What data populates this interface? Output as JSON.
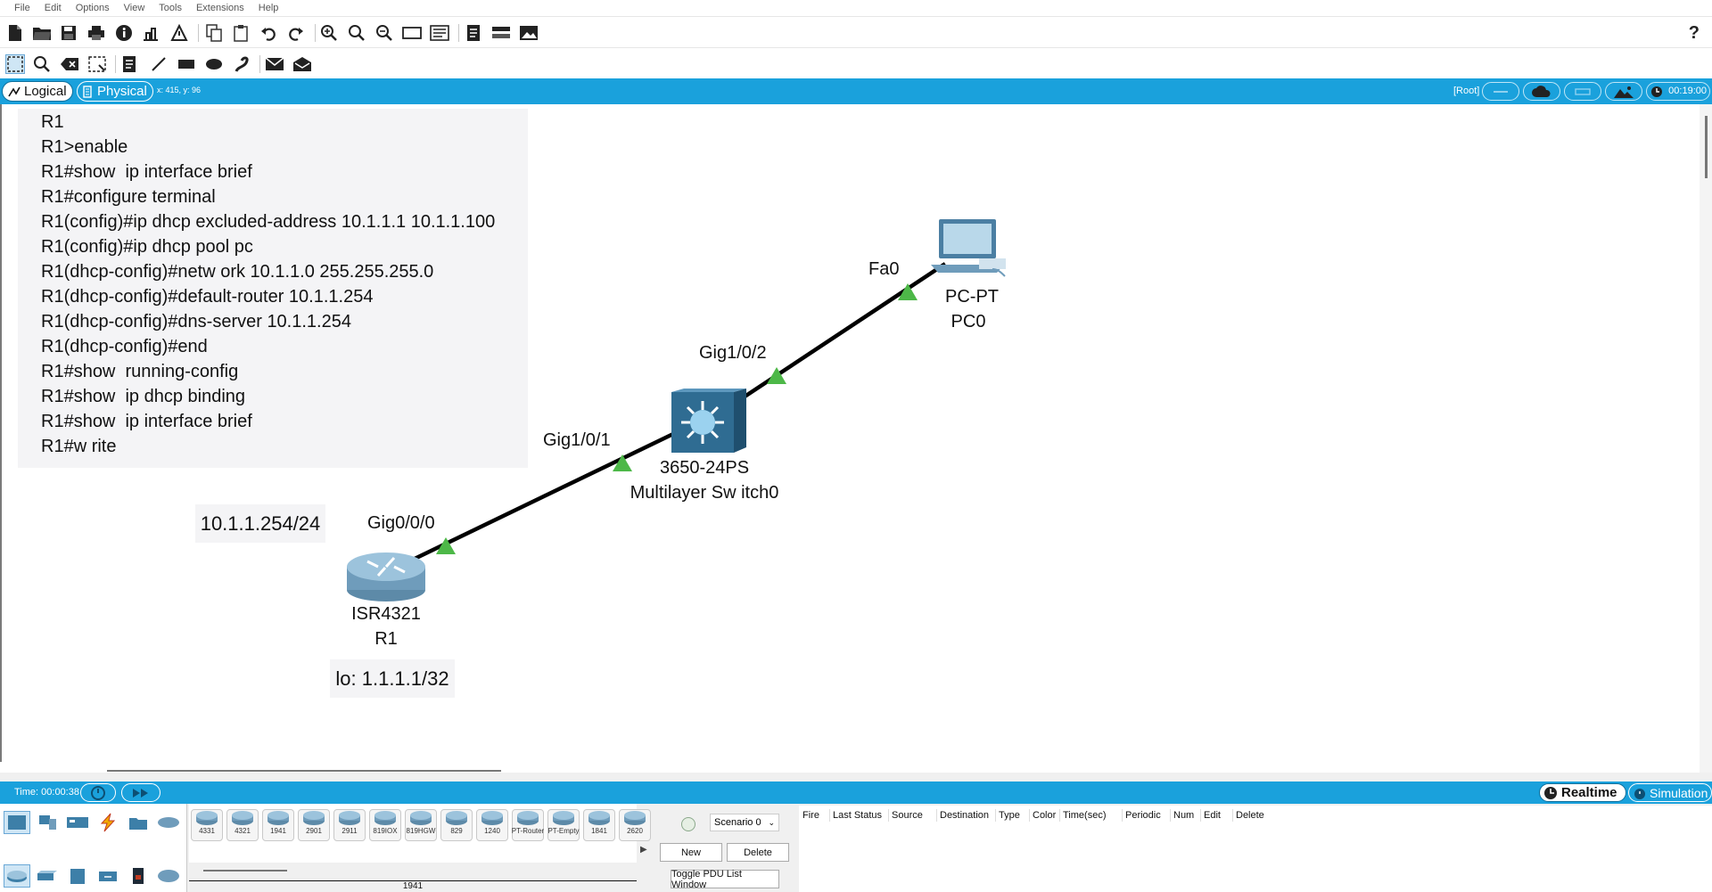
{
  "menu": [
    "File",
    "Edit",
    "Options",
    "View",
    "Tools",
    "Extensions",
    "Help"
  ],
  "workspace": {
    "logical_tab": "Logical",
    "physical_tab": "Physical",
    "coord_readout": "x: 415, y: 96",
    "root_label": "[Root]",
    "clock": "00:19:00"
  },
  "note_lines": [
    "R1",
    "R1>enable",
    "R1#show  ip interface brief",
    "R1#configure terminal",
    "R1(config)#ip dhcp excluded-address 10.1.1.1 10.1.1.100",
    "R1(config)#ip dhcp pool pc",
    "R1(dhcp-config)#netw ork 10.1.1.0 255.255.255.0",
    "R1(dhcp-config)#default-router 10.1.1.254",
    "R1(dhcp-config)#dns-server 10.1.1.254",
    "R1(dhcp-config)#end",
    "R1#show  running-config",
    "R1#show  ip dhcp binding",
    "R1#show  ip interface brief",
    "R1#w rite"
  ],
  "topology": {
    "router": {
      "model": "ISR4321",
      "name": "R1",
      "port": "Gig0/0/0",
      "ip_label": "10.1.1.254/24",
      "loopback_label": "lo: 1.1.1.1/32"
    },
    "switch": {
      "model": "3650-24PS",
      "name": "Multilayer Sw itch0",
      "port_to_router": "Gig1/0/1",
      "port_to_pc": "Gig1/0/2"
    },
    "pc": {
      "model": "PC-PT",
      "name": "PC0",
      "port": "Fa0"
    },
    "link_status_color": "#4db848",
    "link_color": "#000000"
  },
  "bottom": {
    "time": "Time: 00:00:38",
    "realtime": "Realtime",
    "simulation": "Simulation",
    "devices": [
      "4331",
      "4321",
      "1941",
      "2901",
      "2911",
      "819IOX",
      "819HGW",
      "829",
      "1240",
      "PT-Router",
      "PT-Empty",
      "1841",
      "2620"
    ],
    "selected_model": "1941",
    "scenario": "Scenario 0",
    "new_button": "New",
    "delete_button": "Delete",
    "toggle_button": "Toggle PDU List Window",
    "pdu_columns": [
      "Fire",
      "Last Status",
      "Source",
      "Destination",
      "Type",
      "Color",
      "Time(sec)",
      "Periodic",
      "Num",
      "Edit",
      "Delete"
    ]
  },
  "colors": {
    "accent": "#1aa1dc",
    "canvas": "#ffffff",
    "note_bg": "#f4f4f6"
  }
}
